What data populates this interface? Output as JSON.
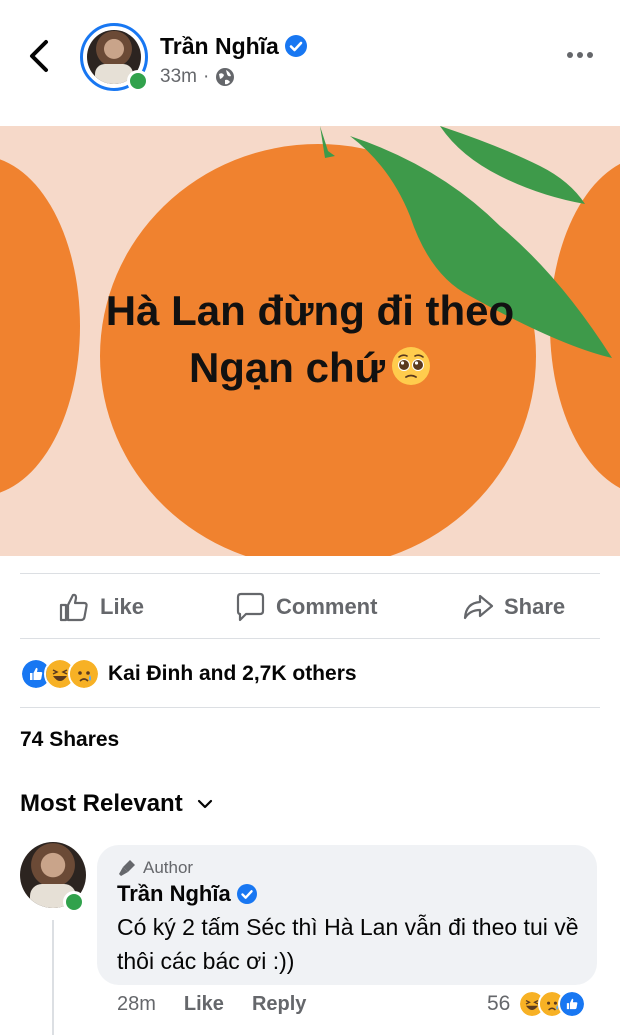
{
  "header": {
    "author_name": "Trần Nghĩa",
    "time": "33m",
    "separator": "·",
    "privacy_icon": "globe-icon"
  },
  "post": {
    "line1": "Hà Lan đừng đi theo",
    "line2": "Ngạn chứ",
    "emoji": "pleading-face",
    "background": "#f6d9c9",
    "orange_color": "#f0822f",
    "leaf_color": "#3e9a4a"
  },
  "actions": {
    "like": "Like",
    "comment": "Comment",
    "share": "Share"
  },
  "reactions": {
    "summary": "Kai Đinh and 2,7K others",
    "shares": "74 Shares"
  },
  "sort": {
    "label": "Most Relevant"
  },
  "comment": {
    "tag": "Author",
    "name": "Trần Nghĩa",
    "text": "Có ký 2 tấm Séc thì Hà Lan vẫn đi theo tui về thôi các bác ơi :))",
    "time": "28m",
    "like": "Like",
    "reply": "Reply",
    "reaction_count": "56"
  },
  "colors": {
    "accent": "#1877f2",
    "online": "#31a24c",
    "secondary_text": "#65676b"
  }
}
